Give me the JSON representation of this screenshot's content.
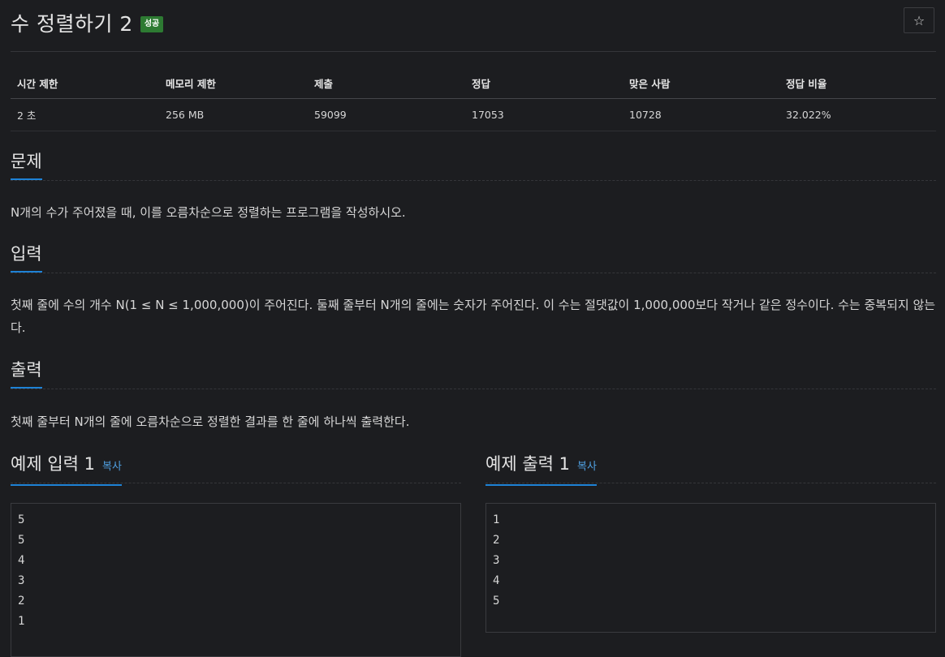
{
  "header": {
    "title": "수 정렬하기 2",
    "badge": "성공",
    "star_icon": "☆"
  },
  "info_table": {
    "headers": [
      "시간 제한",
      "메모리 제한",
      "제출",
      "정답",
      "맞은 사람",
      "정답 비율"
    ],
    "values": [
      "2 초",
      "256 MB",
      "59099",
      "17053",
      "10728",
      "32.022%"
    ]
  },
  "sections": {
    "problem": {
      "title": "문제",
      "text": "N개의 수가 주어졌을 때, 이를 오름차순으로 정렬하는 프로그램을 작성하시오."
    },
    "input": {
      "title": "입력",
      "text": "첫째 줄에 수의 개수 N(1 ≤ N ≤ 1,000,000)이 주어진다. 둘째 줄부터 N개의 줄에는 숫자가 주어진다. 이 수는 절댓값이 1,000,000보다 작거나 같은 정수이다. 수는 중복되지 않는다."
    },
    "output": {
      "title": "출력",
      "text": "첫째 줄부터 N개의 줄에 오름차순으로 정렬한 결과를 한 줄에 하나씩 출력한다."
    }
  },
  "examples": {
    "input": {
      "title": "예제 입력 1",
      "copy_label": "복사",
      "content": "5\n5\n4\n3\n2\n1"
    },
    "output": {
      "title": "예제 출력 1",
      "copy_label": "복사",
      "content": "1\n2\n3\n4\n5"
    }
  },
  "colors": {
    "background": "#1c1d20",
    "accent": "#1e82d6",
    "badge": "#2d7a32",
    "link": "#4f9fe0"
  }
}
